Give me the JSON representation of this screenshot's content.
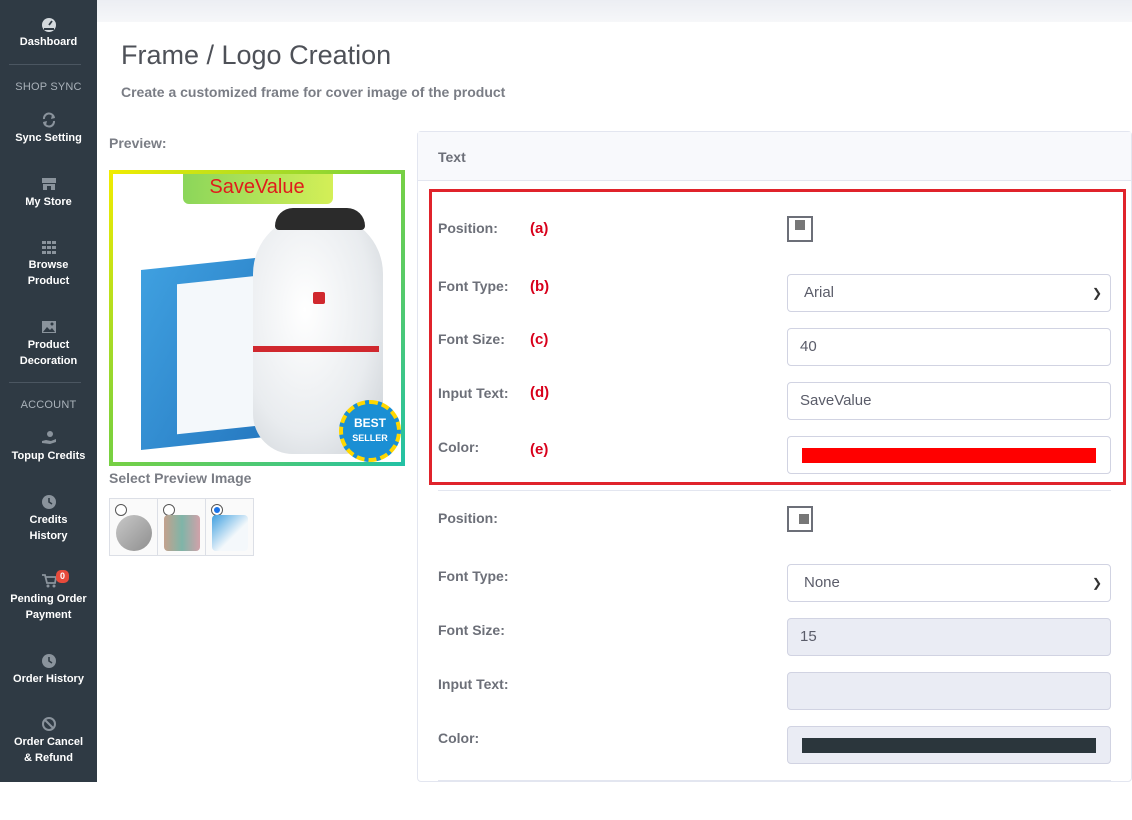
{
  "sidebar": {
    "dashboard": "Dashboard",
    "section_shop_sync": "SHOP SYNC",
    "sync_setting": "Sync Setting",
    "my_store": "My Store",
    "browse_product": [
      "Browse",
      "Product"
    ],
    "product_decoration": [
      "Product",
      "Decoration"
    ],
    "section_account": "ACCOUNT",
    "topup_credits": "Topup Credits",
    "credits_history": [
      "Credits",
      "History"
    ],
    "pending_order_payment": [
      "Pending Order",
      "Payment"
    ],
    "pending_badge": "0",
    "order_history": "Order History",
    "order_cancel_refund": [
      "Order Cancel",
      "& Refund"
    ]
  },
  "page": {
    "title": "Frame / Logo Creation",
    "subtitle": "Create a customized frame for cover image of the product"
  },
  "preview": {
    "label": "Preview:",
    "overlay_text": "SaveValue",
    "select_label": "Select Preview Image",
    "seal_line1": "BEST",
    "seal_line2": "SELLER",
    "selected_thumb_index": 2
  },
  "card": {
    "header": "Text"
  },
  "text1": {
    "position_label": "Position:",
    "font_type_label": "Font Type:",
    "font_size_label": "Font Size:",
    "input_text_label": "Input Text:",
    "color_label": "Color:",
    "markers": [
      "(a)",
      "(b)",
      "(c)",
      "(d)",
      "(e)"
    ],
    "font_type_value": "Arial",
    "font_size_value": "40",
    "input_text_value": "SaveValue",
    "color_value": "#ff0000"
  },
  "text2": {
    "position_label": "Position:",
    "font_type_label": "Font Type:",
    "font_size_label": "Font Size:",
    "input_text_label": "Input Text:",
    "color_label": "Color:",
    "font_type_value": "None",
    "font_size_value": "15",
    "input_text_value": "",
    "color_value": "#2b363c"
  },
  "icons": {
    "dashboard": "tachometer-icon",
    "sync": "sync-icon",
    "store": "store-icon",
    "browse": "grid-icon",
    "decoration": "image-icon",
    "topup": "hand-coin-icon",
    "history": "clock-icon",
    "cart": "cart-icon",
    "cancel": "ban-icon"
  },
  "colors": {
    "sidebar_bg": "#2f3a44",
    "highlight_border": "#e0232b",
    "marker_red": "#d8001b"
  }
}
